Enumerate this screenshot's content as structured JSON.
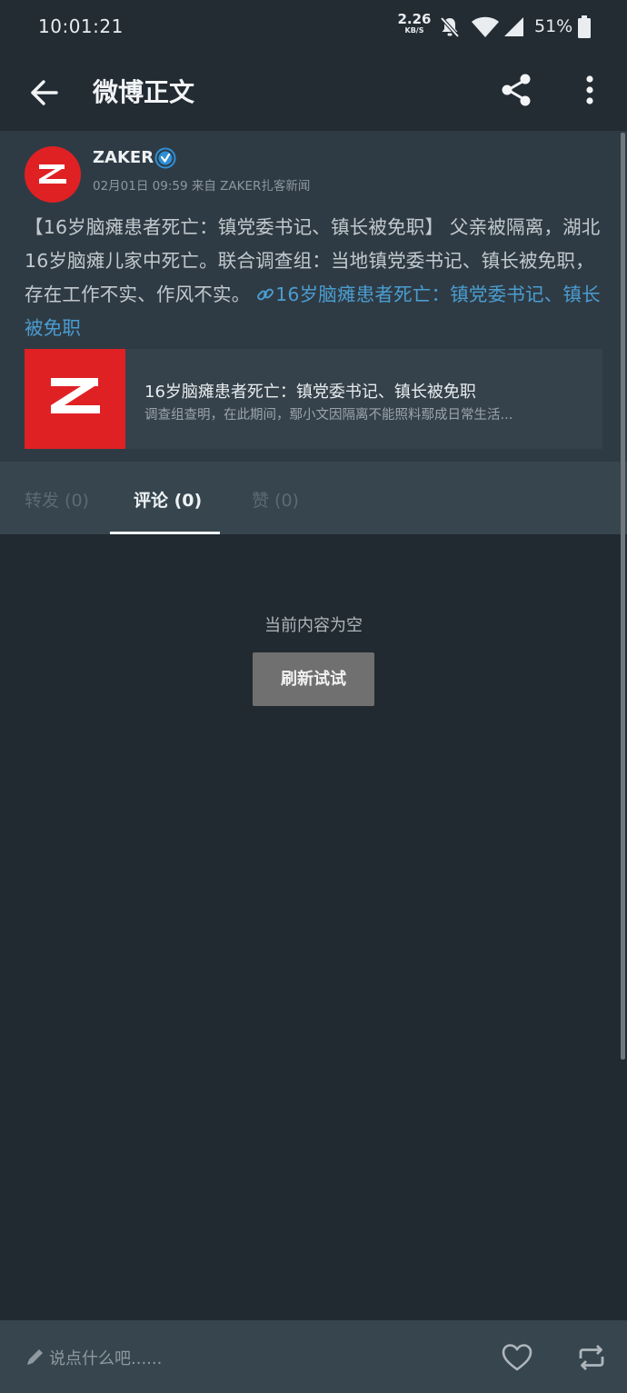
{
  "status_bar": {
    "time": "10:01:21",
    "net_speed": "2.26",
    "net_unit": "KB/S",
    "battery": "51%"
  },
  "appbar": {
    "title": "微博正文",
    "back_icon": "arrow-left-icon",
    "share_icon": "share-icon",
    "more_icon": "more-vert-icon"
  },
  "post": {
    "author": "ZAKER",
    "verified_icon": "verified-badge-icon",
    "meta": "02月01日 09:59 来自 ZAKER扎客新闻",
    "text": "【16岁脑瘫患者死亡：镇党委书记、镇长被免职】 父亲被隔离，湖北16岁脑瘫儿家中死亡。联合调查组：当地镇党委书记、镇长被免职，存在工作不实、作风不实。",
    "link_text": "16岁脑瘫患者死亡：镇党委书记、镇长被免职",
    "card": {
      "title": "16岁脑瘫患者死亡：镇党委书记、镇长被免职",
      "description": "调查组查明，在此期间，鄢小文因隔离不能照料鄢成日常生活..."
    }
  },
  "tabs": [
    {
      "label": "转发 (0)",
      "active": false
    },
    {
      "label": "评论 (0)",
      "active": true
    },
    {
      "label": "赞 (0)",
      "active": false
    }
  ],
  "empty_state": {
    "message": "当前内容为空",
    "button": "刷新试试"
  },
  "bottom_bar": {
    "placeholder": "说点什么吧......",
    "like_icon": "heart-outline-icon",
    "repost_icon": "repost-icon"
  },
  "colors": {
    "background": "#222a31",
    "post_bg": "#2f3b44",
    "link": "#4a9dd1",
    "brand_red": "#e02124"
  }
}
